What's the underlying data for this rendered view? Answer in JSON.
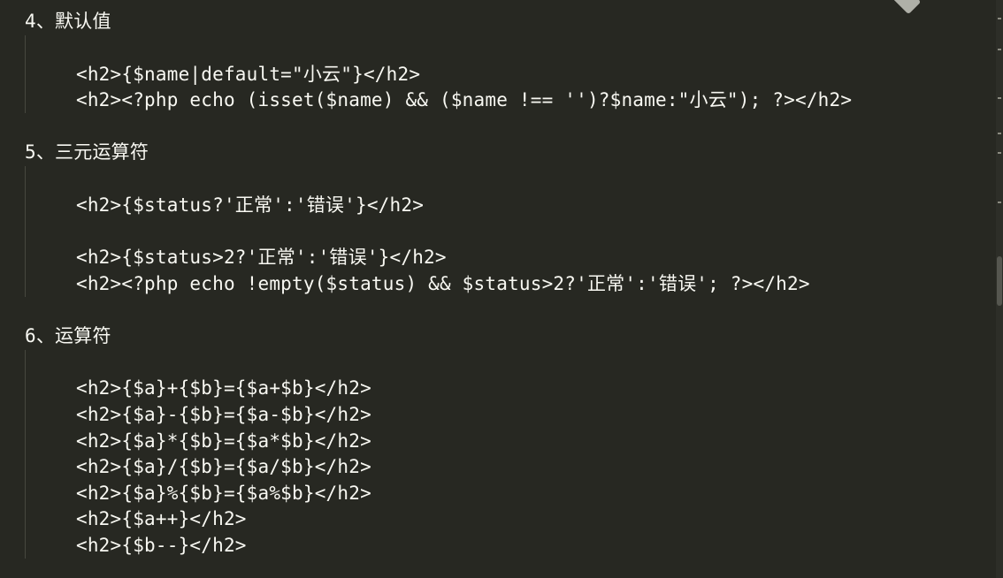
{
  "sections": [
    {
      "heading": "4、默认值",
      "lines": [
        "<h2>{$name|default=\"小云\"}</h2>",
        "<h2><?php echo (isset($name) && ($name !== '')?$name:\"小云\"); ?></h2>"
      ]
    },
    {
      "heading": "5、三元运算符",
      "lines": [
        "<h2>{$status?'正常':'错误'}</h2>",
        "<h2>{$status>2?'正常':'错误'}</h2>",
        "<h2><?php echo !empty($status) && $status>2?'正常':'错误'; ?></h2>"
      ]
    },
    {
      "heading": "6、运算符",
      "lines": [
        "<h2>{$a}+{$b}={$a+$b}</h2>",
        "<h2>{$a}-{$b}={$a-$b}</h2>",
        "<h2>{$a}*{$b}={$a*$b}</h2>",
        "<h2>{$a}/{$b}={$a/$b}</h2>",
        "<h2>{$a}%{$b}={$a%$b}</h2>",
        "<h2>{$a++}</h2>",
        "<h2>{$b--}</h2>"
      ]
    }
  ],
  "colors": {
    "background": "#272822",
    "text": "#f8f8f2"
  }
}
